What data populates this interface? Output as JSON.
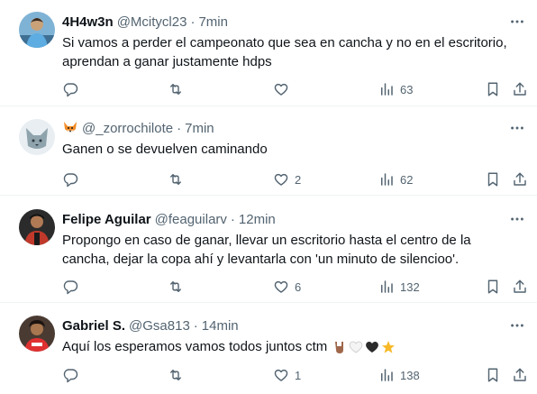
{
  "tweets": [
    {
      "name": "4H4w3n",
      "handle": "@Mcitycl23",
      "time": "7min",
      "lines": [
        "Si vamos a perder el campeonato que sea en cancha y no en el escritorio,",
        "aprendan a ganar justamente hdps"
      ],
      "replies": "",
      "retweets": "",
      "likes": "",
      "views": "63"
    },
    {
      "name": "",
      "handle": "@_zorrochilote",
      "time": "7min",
      "lines": [
        "Ganen o se devuelven caminando"
      ],
      "replies": "",
      "retweets": "",
      "likes": "2",
      "views": "62"
    },
    {
      "name": "Felipe Aguilar",
      "handle": "@feaguilarv",
      "time": "12min",
      "lines": [
        "Propongo en caso de ganar, llevar un escritorio hasta el centro de la",
        "cancha, dejar la copa ahí y levantarla con 'un minuto de silencioo'."
      ],
      "replies": "",
      "retweets": "",
      "likes": "6",
      "views": "132"
    },
    {
      "name": "Gabriel S.",
      "handle": "@Gsa813",
      "time": "14min",
      "lines": [
        "Aquí los esperamos vamos todos juntos ctm"
      ],
      "replies": "",
      "retweets": "",
      "likes": "1",
      "views": "138"
    }
  ],
  "ui": {
    "separator": "·"
  },
  "icons": {
    "reply": "reply-icon",
    "retweet": "retweet-icon",
    "like": "heart-icon",
    "views": "views-chart-icon",
    "bookmark": "bookmark-icon",
    "share": "share-icon",
    "more": "more-icon",
    "fox": "fox-emoji-icon",
    "hand": "rock-hand-emoji-icon",
    "white_heart": "white-heart-emoji-icon",
    "black_heart": "black-heart-emoji-icon",
    "star": "star-emoji-icon"
  },
  "colors": {
    "text": "#0f1419",
    "secondary": "#536471",
    "border": "#eff3f4"
  }
}
